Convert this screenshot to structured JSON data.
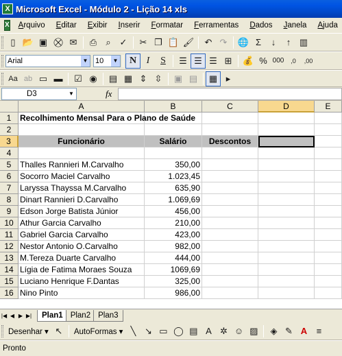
{
  "window": {
    "title": "Microsoft Excel - Módulo 2 - Lição 14 xls"
  },
  "menu": [
    "Arquivo",
    "Editar",
    "Exibir",
    "Inserir",
    "Formatar",
    "Ferramentas",
    "Dados",
    "Janela",
    "Ajuda"
  ],
  "toolbar": {
    "font_name": "Arial",
    "font_size": "10",
    "bold": "N",
    "italic": "I",
    "underline": "S"
  },
  "formula_bar": {
    "cell_ref": "D3",
    "fx": "fx",
    "value": ""
  },
  "columns": [
    "A",
    "B",
    "C",
    "D",
    "E"
  ],
  "rows": [
    "1",
    "2",
    "3",
    "4",
    "5",
    "6",
    "7",
    "8",
    "9",
    "10",
    "11",
    "12",
    "13",
    "14",
    "15",
    "16"
  ],
  "sheet": {
    "title": "Recolhimento Mensal Para o Plano de Saúde",
    "headers": {
      "a": "Funcionário",
      "b": "Salário",
      "c": "Descontos"
    },
    "employees": [
      {
        "name": "Thalles Rannieri M.Carvalho",
        "salary": "350,00"
      },
      {
        "name": "Socorro Maciel Carvalho",
        "salary": "1.023,45"
      },
      {
        "name": "Laryssa Thayssa M.Carvalho",
        "salary": "635,90"
      },
      {
        "name": "Dinart Rannieri D.Carvalho",
        "salary": "1.069,69"
      },
      {
        "name": "Edson Jorge Batista Júnior",
        "salary": "456,00"
      },
      {
        "name": "Athur Garcia Carvalho",
        "salary": "210,00"
      },
      {
        "name": "Gabriel Garcia Carvalho",
        "salary": "423,00"
      },
      {
        "name": "Nestor Antonio O.Carvalho",
        "salary": "982,00"
      },
      {
        "name": "M.Tereza Duarte Carvalho",
        "salary": "444,00"
      },
      {
        "name": "Lígia de Fatima Moraes Souza",
        "salary": "1069,69"
      },
      {
        "name": "Luciano Henrique F.Dantas",
        "salary": "325,00"
      },
      {
        "name": "Nino Pinto",
        "salary": "986,00"
      }
    ]
  },
  "tabs": [
    "Plan1",
    "Plan2",
    "Plan3"
  ],
  "draw": {
    "desenhar": "Desenhar ▾",
    "autoformas": "AutoFormas ▾"
  },
  "status": "Pronto",
  "icons": [
    "new-icon",
    "open-icon",
    "save-icon",
    "permission-icon",
    "email-icon",
    "print-icon",
    "preview-icon",
    "spell-icon",
    "cut-icon",
    "copy-icon",
    "paste-icon",
    "format-painter-icon",
    "undo-icon",
    "redo-icon",
    "hyperlink-icon",
    "autosum-icon",
    "sort-asc-icon",
    "sort-desc-icon"
  ]
}
